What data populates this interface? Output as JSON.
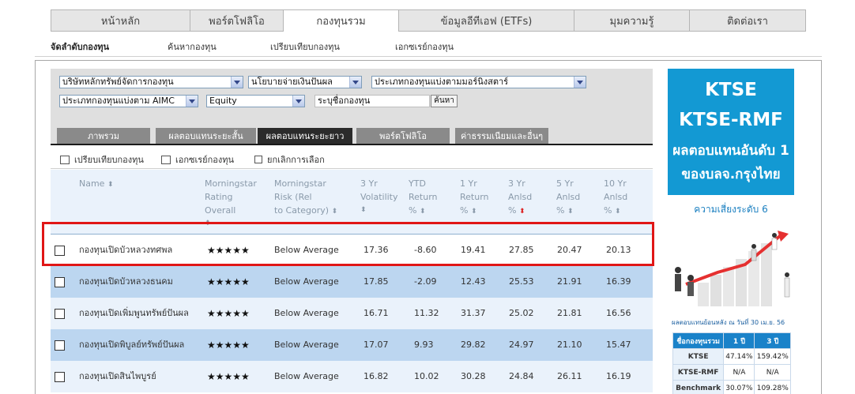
{
  "topnav": [
    {
      "label": "หน้าหลัก",
      "w": 0
    },
    {
      "label": "พอร์ตโฟลิโอ"
    },
    {
      "label": "กองทุนรวม"
    },
    {
      "label": "ข้อมูลอีทีเอฟ (ETFs)"
    },
    {
      "label": "มุมความรู้"
    },
    {
      "label": "ติดต่อเรา"
    }
  ],
  "subnav": [
    "จัดลำดับกองทุน",
    "ค้นหากองทุน",
    "เปรียบเทียบกองทุน",
    "เอกซเรย์กองทุน"
  ],
  "filters": {
    "amc": "บริษัทหลักทรัพย์จัดการกองทุน",
    "dividend": "นโยบายจ่ายเงินปันผล",
    "morningstar_type": "ประเภทกองทุนแบ่งตามมอร์นิ่งสตาร์",
    "aimc_type": "ประเภทกองทุนแบ่งตาม AIMC",
    "asset": "Equity",
    "fund_name_placeholder": "ระบุชื่อกองทุน",
    "search_button": "ค้นหา"
  },
  "result_tabs": [
    "ภาพรวม",
    "ผลตอบแทนระยะสั้น",
    "ผลตอบแทนระยะยาว",
    "พอร์ตโฟลิโอ",
    "ค่าธรรมเนียมและอื่นๆ"
  ],
  "actions": [
    "เปรียบเทียบกองทุน",
    "เอกซเรย์กองทุน",
    "ยกเลิกการเลือก"
  ],
  "columns": {
    "name": "Name",
    "rating": [
      "Morningstar",
      "Rating",
      "Overall"
    ],
    "risk": [
      "Morningstar",
      "Risk (Rel",
      "to Category)"
    ],
    "vol": [
      "3 Yr",
      "Volatility"
    ],
    "ytd": [
      "YTD",
      "Return",
      "%"
    ],
    "r1": [
      "1 Yr",
      "Return",
      "%"
    ],
    "r3": [
      "3 Yr",
      "Anlsd",
      "%"
    ],
    "r5": [
      "5 Yr",
      "Anlsd",
      "%"
    ],
    "r10": [
      "10 Yr",
      "Anlsd",
      "%"
    ]
  },
  "sort_glyph": "⬍",
  "rows": [
    {
      "name": "กองทุนเปิดบัวหลวงทศพล",
      "stars": "★★★★★",
      "risk": "Below Average",
      "vol": "17.36",
      "ytd": "-8.60",
      "r1": "19.41",
      "r3": "27.85",
      "r5": "20.47",
      "r10": "20.13"
    },
    {
      "name": "กองทุนเปิดบัวหลวงธนคม",
      "stars": "★★★★★",
      "risk": "Below Average",
      "vol": "17.85",
      "ytd": "-2.09",
      "r1": "12.43",
      "r3": "25.53",
      "r5": "21.91",
      "r10": "16.39"
    },
    {
      "name": "กองทุนเปิดเพิ่มพูนทรัพย์ปันผล",
      "stars": "★★★★★",
      "risk": "Below Average",
      "vol": "16.71",
      "ytd": "11.32",
      "r1": "31.37",
      "r3": "25.02",
      "r5": "21.81",
      "r10": "16.56"
    },
    {
      "name": "กองทุนเปิดพิบูลย์ทรัพย์ปันผล",
      "stars": "★★★★★",
      "risk": "Below Average",
      "vol": "17.07",
      "ytd": "9.93",
      "r1": "29.82",
      "r3": "24.97",
      "r5": "21.10",
      "r10": "15.47"
    },
    {
      "name": "กองทุนเปิดสินไพบูรย์",
      "stars": "★★★★★",
      "risk": "Below Average",
      "vol": "16.82",
      "ytd": "10.02",
      "r1": "30.28",
      "r3": "24.84",
      "r5": "26.11",
      "r10": "16.19"
    }
  ],
  "ad": {
    "line1": "KTSE",
    "line2": "KTSE-RMF",
    "line3": "ผลตอบแทนอันดับ 1",
    "line4": "ของบลจ.กรุงไทย",
    "risk": "ความเสี่ยงระดับ 6",
    "perf_note": "ผลตอบแทนย้อนหลัง ณ วันที่ 30 เม.ย. 56",
    "table_head": [
      "ชื่อกองทุนรวม",
      "1 ปี",
      "3 ปี"
    ],
    "table_rows": [
      [
        "KTSE",
        "47.14%",
        "159.42%"
      ],
      [
        "KTSE-RMF",
        "N/A",
        "N/A"
      ],
      [
        "Benchmark",
        "30.07%",
        "109.28%"
      ]
    ],
    "brand_color": "#1399d3"
  }
}
